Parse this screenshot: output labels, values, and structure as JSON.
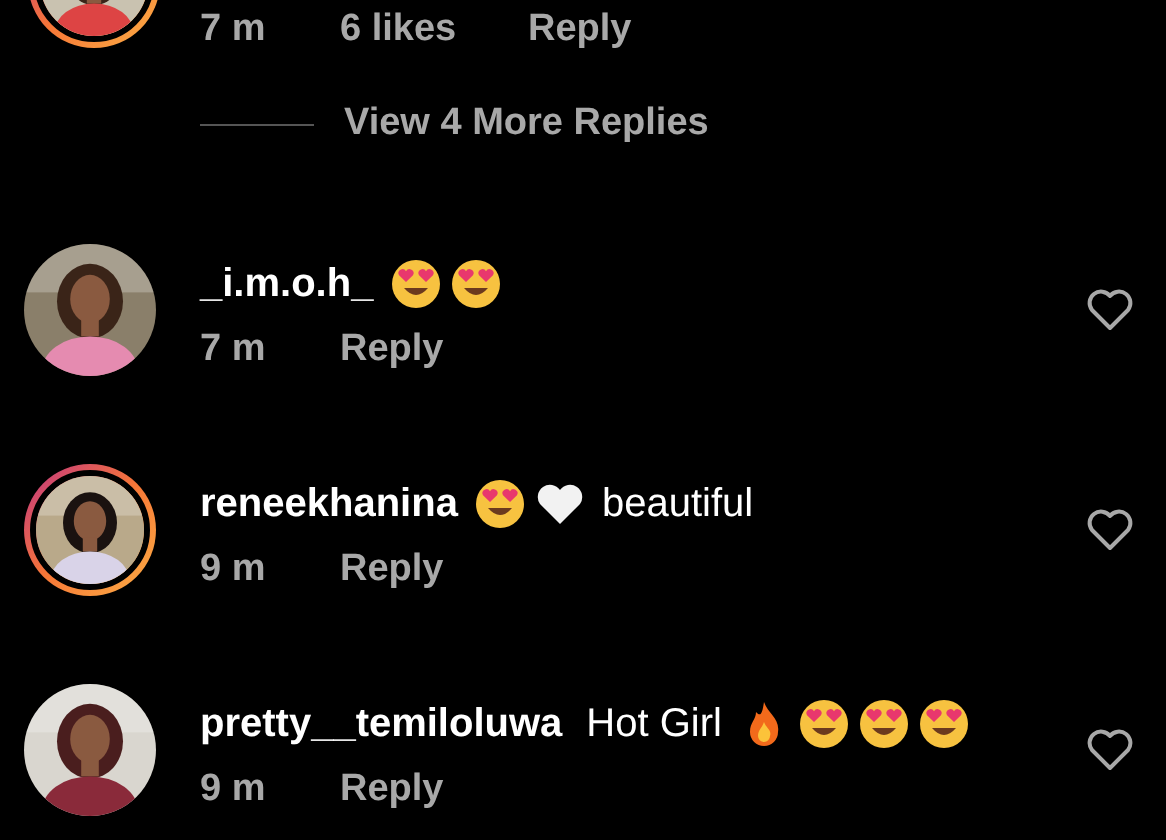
{
  "top_comment": {
    "story_ring": true,
    "time": "7 m",
    "likes": "6 likes",
    "reply": "Reply"
  },
  "view_more": "View 4 More Replies",
  "comments": [
    {
      "username": "_i.m.o.h_",
      "story_ring": false,
      "parts": [
        {
          "kind": "heart_eyes"
        },
        {
          "kind": "heart_eyes"
        }
      ],
      "time": "7 m",
      "reply": "Reply",
      "liked": false
    },
    {
      "username": "reneekhanina",
      "story_ring": true,
      "parts": [
        {
          "kind": "heart_eyes"
        },
        {
          "kind": "white_heart"
        },
        {
          "kind": "text",
          "text": "beautiful"
        }
      ],
      "time": "9 m",
      "reply": "Reply",
      "liked": false
    },
    {
      "username": "pretty__temiloluwa",
      "story_ring": false,
      "parts": [
        {
          "kind": "text",
          "text": "Hot Girl"
        },
        {
          "kind": "fire"
        },
        {
          "kind": "heart_eyes"
        },
        {
          "kind": "heart_eyes"
        },
        {
          "kind": "heart_eyes"
        }
      ],
      "time": "9 m",
      "reply": "Reply",
      "liked": false
    }
  ]
}
